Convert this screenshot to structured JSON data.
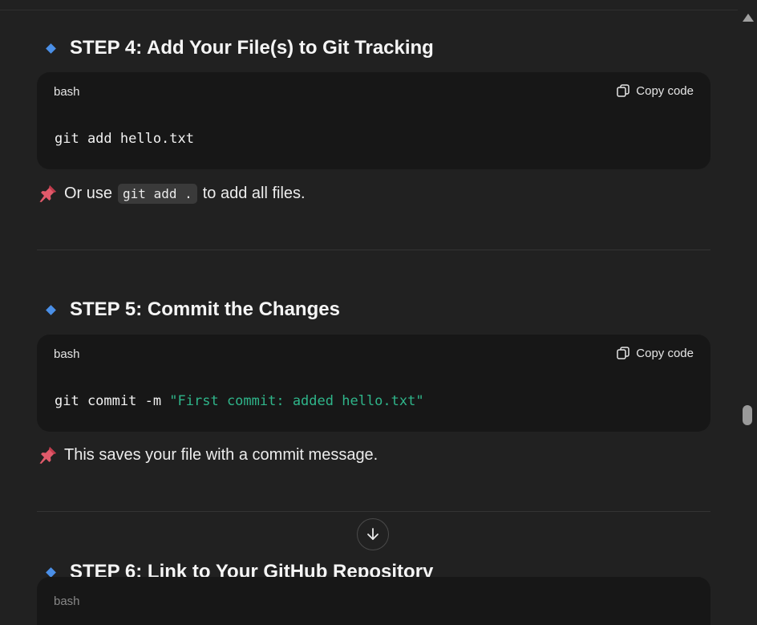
{
  "steps": [
    {
      "heading": "STEP 4: Add Your File(s) to Git Tracking",
      "code_lang": "bash",
      "copy_label": "Copy code",
      "code_plain": "git add hello.txt",
      "code_string": "",
      "note_before": "Or use",
      "note_code": "git add .",
      "note_after": "to add all files."
    },
    {
      "heading": "STEP 5: Commit the Changes",
      "code_lang": "bash",
      "copy_label": "Copy code",
      "code_plain": "git commit -m ",
      "code_string": "\"First commit: added hello.txt\"",
      "note_text": "This saves your file with a commit message."
    },
    {
      "heading": "STEP 6: Link to Your GitHub Repository",
      "code_lang": "bash"
    }
  ],
  "icons": {
    "step_marker": "blue-diamond-icon",
    "note_marker": "pushpin-icon",
    "copy": "copy-icon",
    "scroll_down": "arrow-down-icon"
  },
  "colors": {
    "background": "#212121",
    "code_background": "#171717",
    "diamond": "#4a8fe7",
    "string": "#2fb58a"
  }
}
